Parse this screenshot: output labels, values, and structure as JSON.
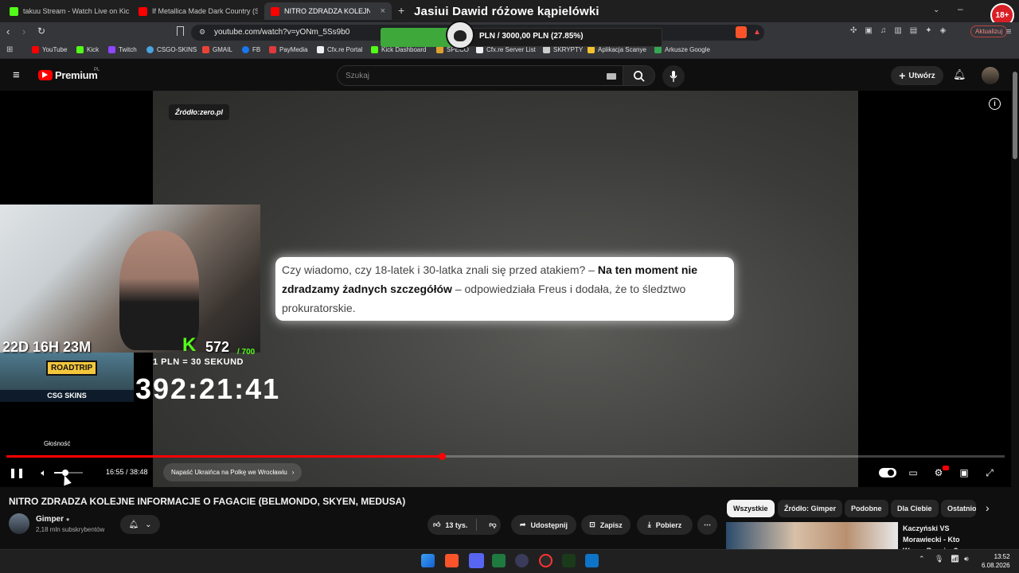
{
  "browser": {
    "tabs": [
      {
        "label": "takuu Stream - Watch Live on Kick",
        "color": "#53fc18"
      },
      {
        "label": "If Metallica Made Dark Country (Seek",
        "color": "#ff0000"
      },
      {
        "label": "NITRO ZDRADZA KOLEJNE INFORMACJE",
        "color": "#ff0000",
        "active": true
      }
    ],
    "new_tab": "+",
    "url": "youtube.com/watch?v=yONm_5Ss9b0",
    "update_label": "Aktualizuj",
    "bookmarks": [
      {
        "label": "YouTube",
        "color": "#ff0000"
      },
      {
        "label": "Kick",
        "color": "#53fc18"
      },
      {
        "label": "Twitch",
        "color": "#9146ff"
      },
      {
        "label": "CSGO-SKINS",
        "color": "#4aa3df"
      },
      {
        "label": "GMAIL",
        "color": "#ea4335"
      },
      {
        "label": "FB",
        "color": "#1877f2"
      },
      {
        "label": "PayMedia",
        "color": "#e03a3a"
      },
      {
        "label": "Cfx.re Portal",
        "color": "#f0f0f0"
      },
      {
        "label": "Kick Dashboard",
        "color": "#53fc18"
      },
      {
        "label": "SPECO",
        "color": "#e0a030"
      },
      {
        "label": "Cfx.re Server List",
        "color": "#f0f0f0"
      },
      {
        "label": "SKRYPTY",
        "color": "#cccccc"
      },
      {
        "label": "Aplikacja Scanye",
        "color": "#f2c230"
      },
      {
        "label": "Arkusze Google",
        "color": "#34a853"
      }
    ]
  },
  "overlay": {
    "stream_title": "Jasiui Dawid różowe kąpielówki",
    "donation_text": "PLN / 3000,00 PLN  (27.85%)",
    "donation_progress": 0.2785,
    "age_badge": "18+",
    "countdown": "22D 16H 23M",
    "kick_logo": "K",
    "kick_count": "572",
    "kick_max": "/ 700",
    "rate": "1 PLN = 30 SEKUND",
    "timer": "392:21:41",
    "roadtrip": "ROADTRIP",
    "csg_label": "CSG SKINS"
  },
  "youtube": {
    "logo": "Premium",
    "logo_region": "PL",
    "search_placeholder": "Szukaj",
    "create_label": "Utwórz",
    "video": {
      "source_badge": "Źródło:zero.pl",
      "quote_part1": "Czy wiadomo, czy 18-latek i 30-latka znali się przed atakiem? – ",
      "quote_bold": "Na ten moment nie zdradzamy żadnych szczegółów",
      "quote_part2": " – odpowiedziała Freus i dodała, że to śledztwo prokuratorskie.",
      "tooltip": "Głośność",
      "time": "16:55 / 38:48",
      "progress": 0.436,
      "volume": 0.4,
      "chapter": "Napaść Ukraińca na Polkę we Wrocławiu"
    },
    "title": "NITRO ZDRADZA KOLEJNE INFORMACJE O FAGACIE (BELMONDO, SKYEN, MEDUSA)",
    "channel": "Gimper",
    "subscribers": "2,18 mln subskrybentów",
    "likes": "13 tys.",
    "share": "Udostępnij",
    "save": "Zapisz",
    "download": "Pobierz",
    "chips": [
      "Wszystkie",
      "Źródło: Gimper",
      "Podobne",
      "Dla Ciebie",
      "Ostatnio"
    ],
    "rec_title": "Kaczyński VS Morawiecki - Kto Wygra Prawice?"
  },
  "taskbar": {
    "time": "13:52",
    "date": "6.08.2026"
  }
}
